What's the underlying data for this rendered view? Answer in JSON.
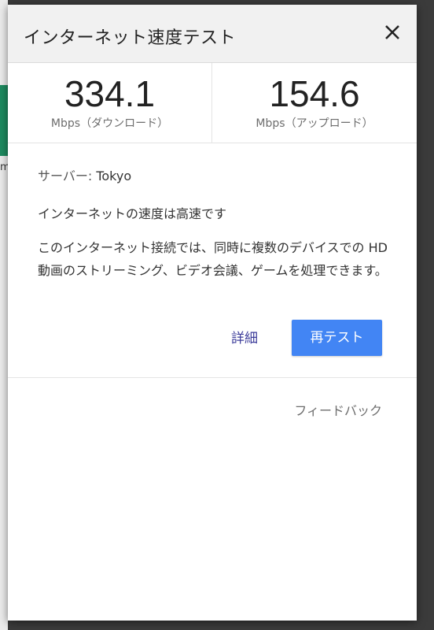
{
  "background": {
    "edge_glyph": "m",
    "accent_color": "#1d8a5f"
  },
  "dialog": {
    "title": "インターネット速度テスト",
    "close_icon": "close-icon"
  },
  "metrics": {
    "download": {
      "value": "334.1",
      "unit": "Mbps（ダウンロード）"
    },
    "upload": {
      "value": "154.6",
      "unit": "Mbps（アップロード）"
    }
  },
  "info": {
    "server_label": "サーバー: ",
    "server_value": "Tokyo",
    "status": "インターネットの速度は高速です",
    "description": "このインターネット接続では、同時に複数のデバイスでの HD 動画のストリーミング、ビデオ会議、ゲームを処理できます。"
  },
  "actions": {
    "details_label": "詳細",
    "retest_label": "再テスト",
    "retest_color": "#4285f4"
  },
  "footer": {
    "feedback_label": "フィードバック"
  }
}
